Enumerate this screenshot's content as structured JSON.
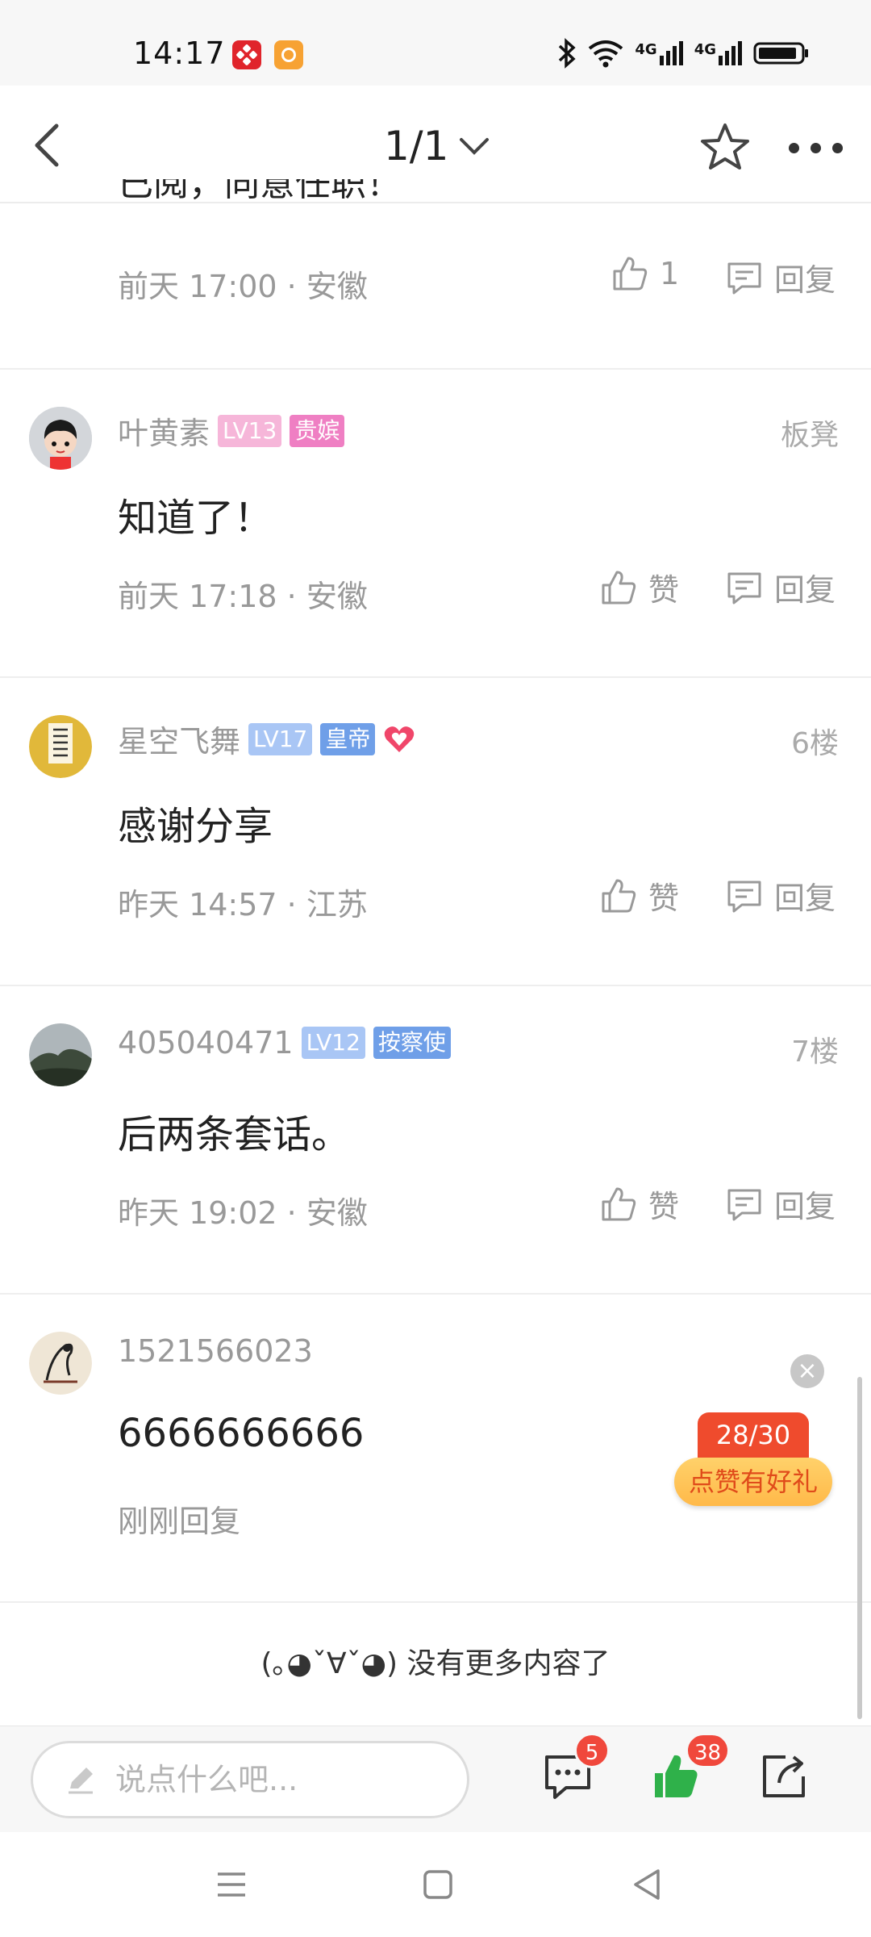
{
  "status_bar": {
    "time": "14:17",
    "network1": "4G",
    "network2": "4G"
  },
  "nav": {
    "pager": "1/1"
  },
  "cutoff_text": "已阅，同意任职！",
  "comments": [
    {
      "meta": "前天 17:00 · 安徽",
      "like_label": "1",
      "reply_label": "回复"
    },
    {
      "name": "叶黄素",
      "level": "LV13",
      "title": "贵嫔",
      "floor": "板凳",
      "text": "知道了！",
      "meta": "前天 17:18 · 安徽",
      "like_label": "赞",
      "reply_label": "回复"
    },
    {
      "name": "星空飞舞",
      "level": "LV17",
      "title": "皇帝",
      "floor": "6楼",
      "text": "感谢分享",
      "meta": "昨天 14:57 · 江苏",
      "like_label": "赞",
      "reply_label": "回复"
    },
    {
      "name": "405040471",
      "level": "LV12",
      "title": "按察使",
      "floor": "7楼",
      "text": "后两条套话。",
      "meta": "昨天 19:02 · 安徽",
      "like_label": "赞",
      "reply_label": "回复"
    },
    {
      "name": "1521566023",
      "text": "6666666666",
      "meta": "刚刚回复"
    }
  ],
  "promo": {
    "count": "28/30",
    "label": "点赞有好礼"
  },
  "end_text": "(｡◕ˇ∀ˇ◕) 没有更多内容了",
  "input": {
    "placeholder": "说点什么吧..."
  },
  "bottom": {
    "comment_count": "5",
    "like_count": "38"
  },
  "colors": {
    "like_green": "#2fb14a",
    "badge_red": "#f0483c",
    "lv_pink": "#f6b6d9",
    "title_pink": "#ef7fc3",
    "lv_blue": "#a9c6f5",
    "title_blue": "#6f9fe8"
  }
}
